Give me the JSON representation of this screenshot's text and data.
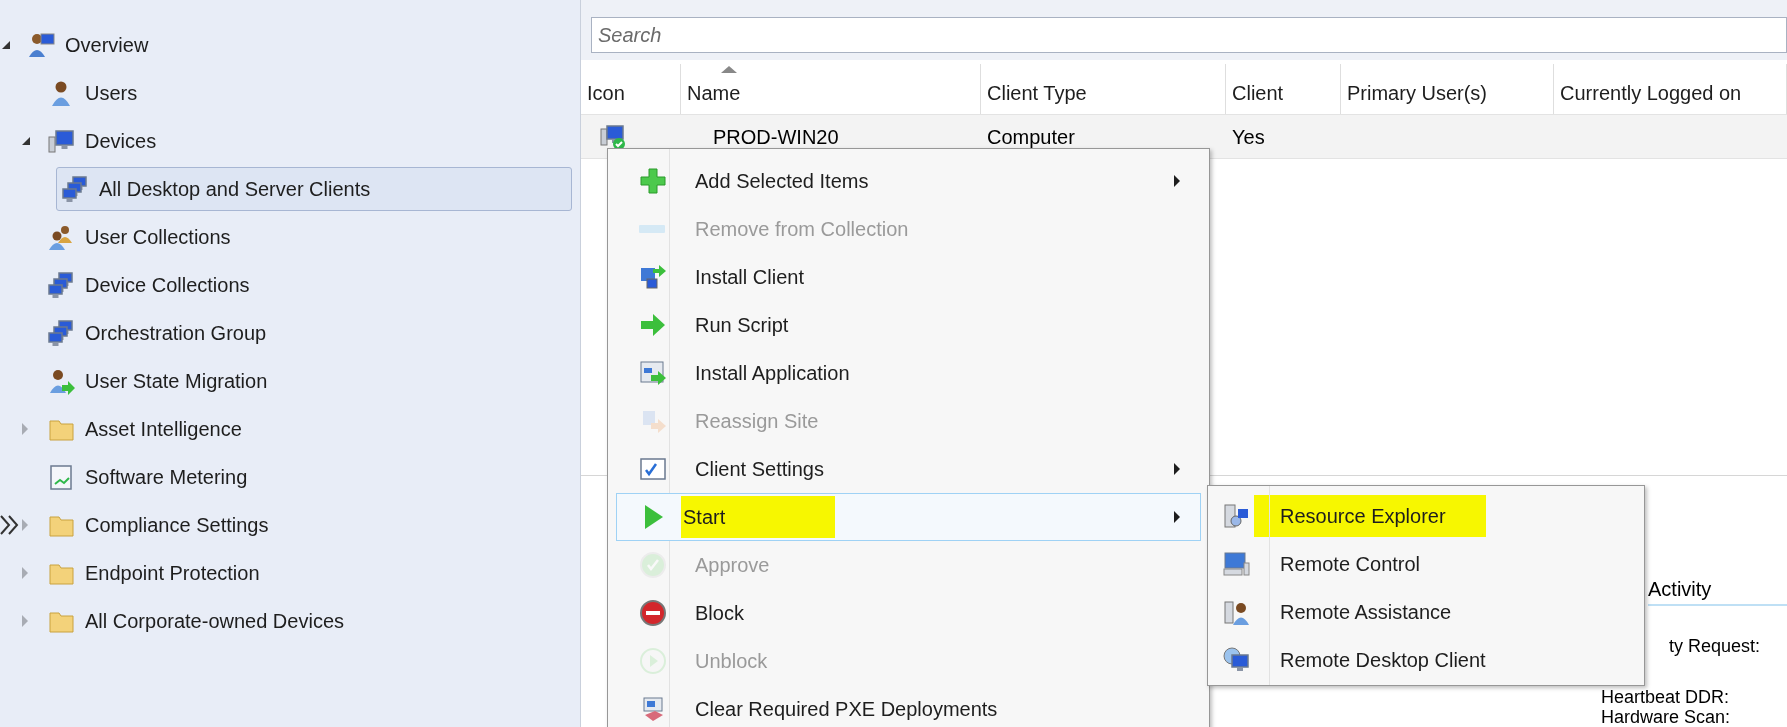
{
  "tree": [
    {
      "label": "Overview",
      "kind": "overview",
      "expanded": true,
      "selected": false,
      "children": [
        {
          "label": "Users",
          "kind": "user",
          "selected": false
        },
        {
          "label": "Devices",
          "kind": "devices",
          "expanded": true,
          "selected": false,
          "children": [
            {
              "label": "All Desktop and Server Clients",
              "kind": "collection",
              "selected": true
            }
          ]
        },
        {
          "label": "User Collections",
          "kind": "usergroup",
          "selected": false
        },
        {
          "label": "Device Collections",
          "kind": "collection",
          "selected": false
        },
        {
          "label": "Orchestration Group",
          "kind": "collection",
          "selected": false
        },
        {
          "label": "User State Migration",
          "kind": "migration",
          "selected": false
        },
        {
          "label": "Asset Intelligence",
          "kind": "folder",
          "expanded": false,
          "selected": false
        },
        {
          "label": "Software Metering",
          "kind": "metering",
          "selected": false
        },
        {
          "label": "Compliance Settings",
          "kind": "folder",
          "expanded": false,
          "selected": false
        },
        {
          "label": "Endpoint Protection",
          "kind": "folder",
          "expanded": false,
          "selected": false
        },
        {
          "label": "All Corporate-owned Devices",
          "kind": "folder",
          "expanded": false,
          "selected": false
        }
      ]
    }
  ],
  "search": {
    "placeholder": "Search"
  },
  "table": {
    "columns": [
      {
        "label": "Icon",
        "sorted": false
      },
      {
        "label": "Name",
        "sorted": true
      },
      {
        "label": "Client Type",
        "sorted": false
      },
      {
        "label": "Client",
        "sorted": false
      },
      {
        "label": "Primary User(s)",
        "sorted": false
      },
      {
        "label": "Currently Logged on",
        "sorted": false
      }
    ],
    "rows": [
      {
        "cells": [
          "",
          "PROD-WIN20",
          "Computer",
          "Yes"
        ]
      }
    ]
  },
  "details": {
    "heading": "Activity",
    "lines": [
      "ty Request:",
      "Heartbeat DDR:",
      "Hardware Scan:"
    ]
  },
  "context_menu": [
    {
      "label": "Add Selected Items",
      "kind": "plus",
      "disabled": false,
      "submenu": true,
      "selected": false,
      "highlighted": false
    },
    {
      "label": "Remove from Collection",
      "kind": "remove",
      "disabled": true,
      "submenu": false,
      "selected": false,
      "highlighted": false
    },
    {
      "label": "Install Client",
      "kind": "install",
      "disabled": false,
      "submenu": false,
      "selected": false,
      "highlighted": false
    },
    {
      "label": "Run Script",
      "kind": "arrow",
      "disabled": false,
      "submenu": false,
      "selected": false,
      "highlighted": false
    },
    {
      "label": "Install Application",
      "kind": "app",
      "disabled": false,
      "submenu": false,
      "selected": false,
      "highlighted": false
    },
    {
      "label": "Reassign Site",
      "kind": "reassign",
      "disabled": true,
      "submenu": false,
      "selected": false,
      "highlighted": false
    },
    {
      "label": "Client Settings",
      "kind": "settings",
      "disabled": false,
      "submenu": true,
      "selected": false,
      "highlighted": false
    },
    {
      "label": "Start",
      "kind": "play",
      "disabled": false,
      "submenu": true,
      "selected": true,
      "highlighted": true
    },
    {
      "label": "Approve",
      "kind": "approve",
      "disabled": true,
      "submenu": false,
      "selected": false,
      "highlighted": false
    },
    {
      "label": "Block",
      "kind": "block",
      "disabled": false,
      "submenu": false,
      "selected": false,
      "highlighted": false
    },
    {
      "label": "Unblock",
      "kind": "unblock",
      "disabled": true,
      "submenu": false,
      "selected": false,
      "highlighted": false
    },
    {
      "label": "Clear Required PXE Deployments",
      "kind": "pxe",
      "disabled": false,
      "submenu": false,
      "selected": false,
      "highlighted": false
    }
  ],
  "submenu": [
    {
      "label": "Resource Explorer",
      "kind": "explorer",
      "highlighted": true
    },
    {
      "label": "Remote Control",
      "kind": "remote",
      "highlighted": false
    },
    {
      "label": "Remote Assistance",
      "kind": "assist",
      "highlighted": false
    },
    {
      "label": "Remote Desktop Client",
      "kind": "rdp",
      "highlighted": false
    }
  ]
}
